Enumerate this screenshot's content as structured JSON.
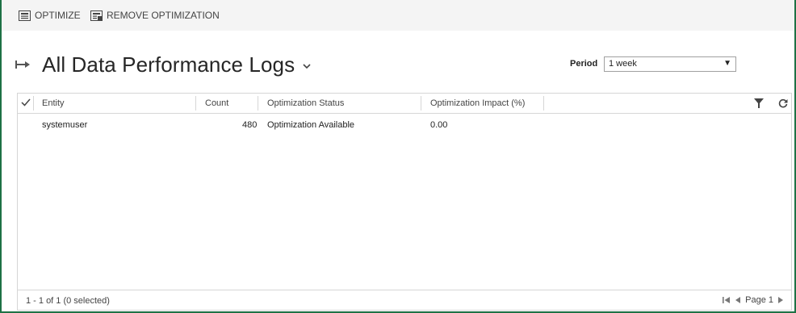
{
  "toolbar": {
    "optimize_label": "OPTIMIZE",
    "remove_label": "REMOVE OPTIMIZATION"
  },
  "view": {
    "title": "All Data Performance Logs"
  },
  "period": {
    "label": "Period",
    "selected": "1 week"
  },
  "grid": {
    "columns": [
      "Entity",
      "Count",
      "Optimization Status",
      "Optimization Impact (%)"
    ],
    "rows": [
      {
        "entity": "systemuser",
        "count": "480",
        "status": "Optimization Available",
        "impact": "0.00"
      }
    ],
    "footer": {
      "count_text": "1 - 1 of 1 (0 selected)",
      "page_text": "Page 1"
    }
  },
  "colors": {
    "border_accent": "#1e7145",
    "toolbar_bg": "#f4f4f4"
  }
}
